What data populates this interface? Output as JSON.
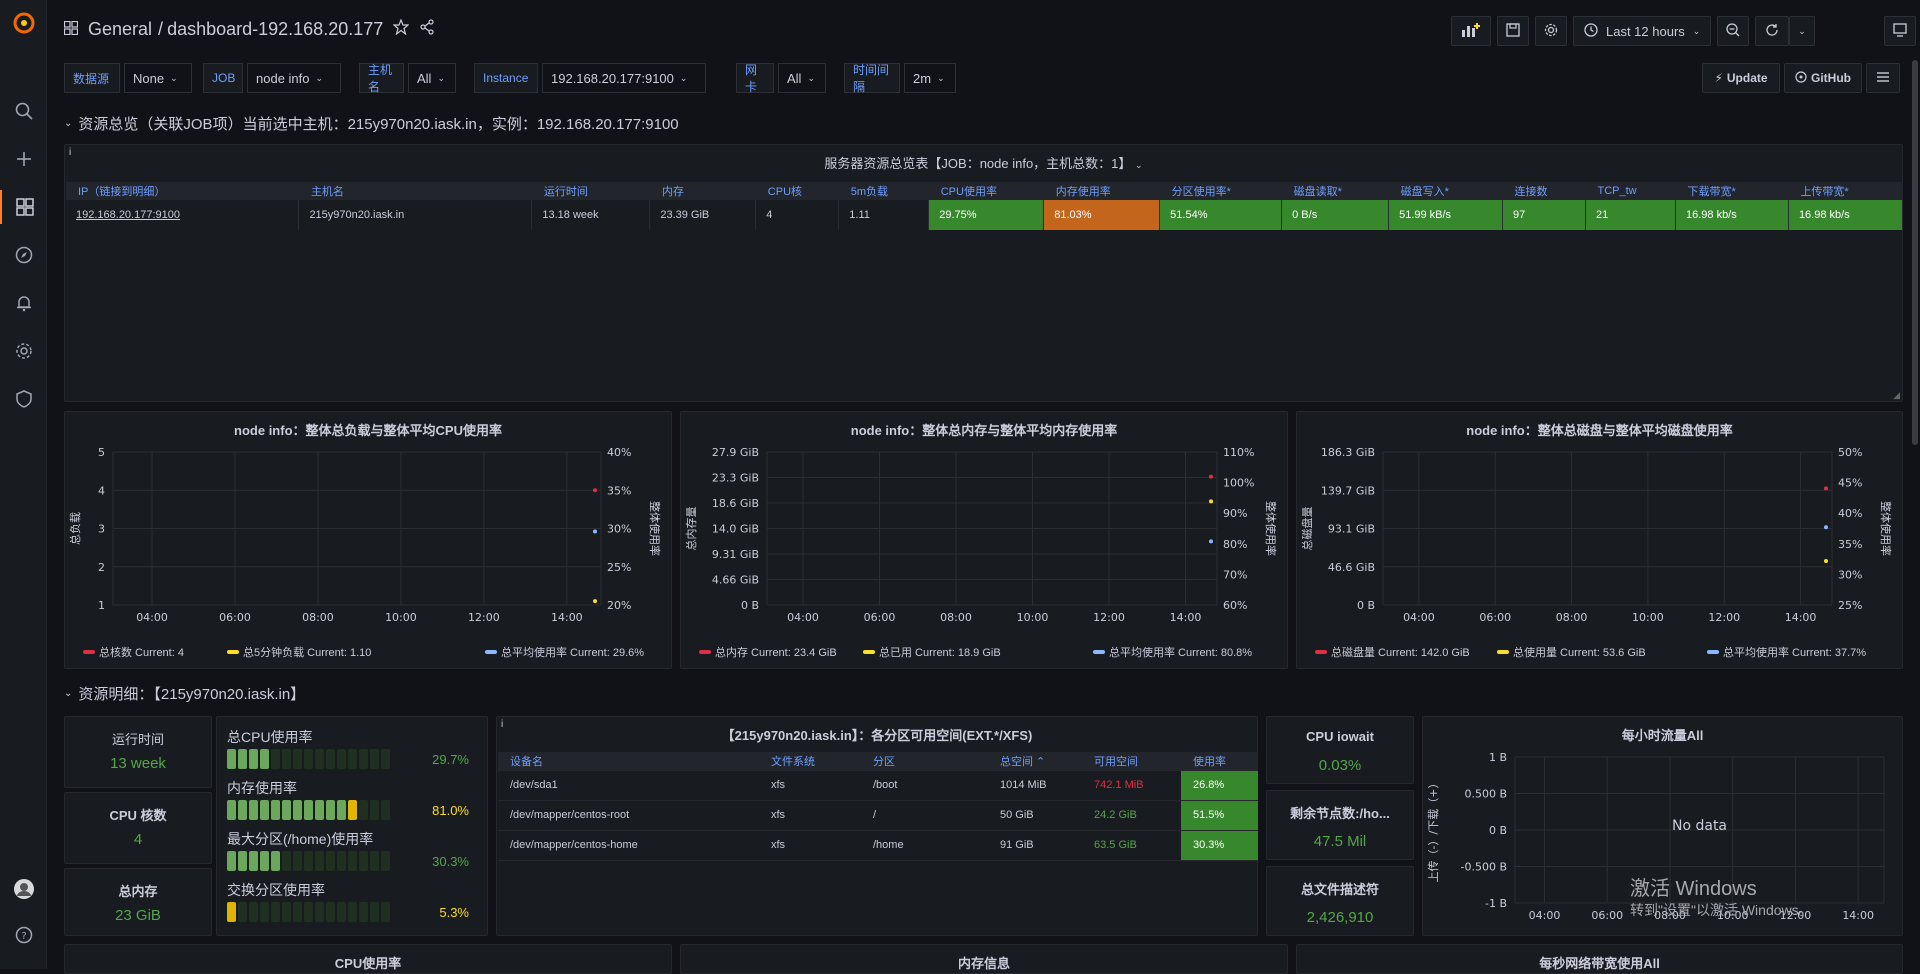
{
  "topbar": {
    "breadcrumb_folder": "General",
    "breadcrumb_sep": "/",
    "dashboard_name": "dashboard-192.168.20.177",
    "time_range": "Last 12 hours",
    "update_label": "Update",
    "github_label": "GitHub"
  },
  "variables": [
    {
      "label": "数据源",
      "value": "None"
    },
    {
      "label": "JOB",
      "value": "node info"
    },
    {
      "label": "主机名",
      "value": "All"
    },
    {
      "label": "Instance",
      "value": "192.168.20.177:9100"
    },
    {
      "label": "网卡",
      "value": "All"
    },
    {
      "label": "时间间隔",
      "value": "2m"
    }
  ],
  "row1_title": "资源总览（关联JOB项）当前选中主机：215y970n20.iask.in，实例：192.168.20.177:9100",
  "overview_panel": {
    "title": "服务器资源总览表【JOB：node info，主机总数：1】",
    "info": "i",
    "columns": [
      "IP（链接到明细）",
      "主机名",
      "运行时间",
      "内存",
      "CPU核",
      "5m负载",
      "CPU使用率",
      "内存使用率",
      "分区使用率*",
      "磁盘读取*",
      "磁盘写入*",
      "连接数",
      "TCP_tw",
      "下载带宽*",
      "上传带宽*"
    ],
    "row": [
      "192.168.20.177:9100",
      "215y970n20.iask.in",
      "13.18 week",
      "23.39 GiB",
      "4",
      "1.11",
      "29.75%",
      "81.03%",
      "51.54%",
      "0 B/s",
      "51.99 kB/s",
      "97",
      "21",
      "16.98 kb/s",
      "16.98 kb/s"
    ]
  },
  "chart_data": [
    {
      "type": "line",
      "title": "node info：整体总负载与整体平均CPU使用率",
      "ylabel": "总负载",
      "y2label": "整体使用率",
      "x": [
        "04:00",
        "06:00",
        "08:00",
        "10:00",
        "12:00",
        "14:00"
      ],
      "yticks": [
        "5",
        "4",
        "3",
        "2",
        "1"
      ],
      "y2ticks": [
        "40%",
        "35%",
        "30%",
        "25%",
        "20%"
      ],
      "ylim": [
        1,
        5
      ],
      "y2lim": [
        20,
        40
      ],
      "series": [
        {
          "name": "总核数",
          "color": "#e02f44",
          "legend": "总核数  Current: 4",
          "axis": "left",
          "value": 4
        },
        {
          "name": "总5分钟负载",
          "color": "#fade2a",
          "legend": "总5分钟负载  Current: 1.10",
          "axis": "left",
          "value": 1.1
        },
        {
          "name": "总平均使用率",
          "color": "#8ab8ff",
          "legend": "总平均使用率  Current: 29.6%",
          "axis": "right",
          "value": 29.6
        }
      ]
    },
    {
      "type": "line",
      "title": "node info：整体总内存与整体平均内存使用率",
      "ylabel": "总内存量",
      "y2label": "整体使用率",
      "x": [
        "04:00",
        "06:00",
        "08:00",
        "10:00",
        "12:00",
        "14:00"
      ],
      "yticks": [
        "27.9 GiB",
        "23.3 GiB",
        "18.6 GiB",
        "14.0 GiB",
        "9.31 GiB",
        "4.66 GiB",
        "0 B"
      ],
      "y2ticks": [
        "110%",
        "100%",
        "90%",
        "80%",
        "70%",
        "60%"
      ],
      "ylim": [
        0,
        27.9
      ],
      "y2lim": [
        60,
        110
      ],
      "series": [
        {
          "name": "总内存",
          "color": "#e02f44",
          "legend": "总内存  Current: 23.4 GiB",
          "axis": "left",
          "value": 23.4
        },
        {
          "name": "总已用",
          "color": "#fade2a",
          "legend": "总已用  Current: 18.9 GiB",
          "axis": "left",
          "value": 18.9
        },
        {
          "name": "总平均使用率",
          "color": "#8ab8ff",
          "legend": "总平均使用率  Current: 80.8%",
          "axis": "right",
          "value": 80.8
        }
      ]
    },
    {
      "type": "line",
      "title": "node info：整体总磁盘与整体平均磁盘使用率",
      "ylabel": "总磁盘量",
      "y2label": "整体使用率",
      "x": [
        "04:00",
        "06:00",
        "08:00",
        "10:00",
        "12:00",
        "14:00"
      ],
      "yticks": [
        "186.3 GiB",
        "139.7 GiB",
        "93.1 GiB",
        "46.6 GiB",
        "0 B"
      ],
      "y2ticks": [
        "50%",
        "45%",
        "40%",
        "35%",
        "30%",
        "25%"
      ],
      "ylim": [
        0,
        186.3
      ],
      "y2lim": [
        25,
        50
      ],
      "series": [
        {
          "name": "总磁盘量",
          "color": "#e02f44",
          "legend": "总磁盘量  Current: 142.0 GiB",
          "axis": "left",
          "value": 142.0
        },
        {
          "name": "总使用量",
          "color": "#fade2a",
          "legend": "总使用量  Current: 53.6 GiB",
          "axis": "left",
          "value": 53.6
        },
        {
          "name": "总平均使用率",
          "color": "#8ab8ff",
          "legend": "总平均使用率  Current: 37.7%",
          "axis": "right",
          "value": 37.7
        }
      ]
    },
    {
      "type": "line",
      "title": "每小时流量All",
      "ylabel": "上传（-）/下载（+）",
      "x": [
        "04:00",
        "06:00",
        "08:00",
        "10:00",
        "12:00",
        "14:00"
      ],
      "yticks": [
        "1 B",
        "0.500 B",
        "0 B",
        "-0.500 B",
        "-1 B"
      ],
      "ylim": [
        -1,
        1
      ],
      "no_data": "No data",
      "series": []
    }
  ],
  "row2_title": "资源明细：【215y970n20.iask.in】",
  "stats": {
    "uptime_label": "运行时间",
    "uptime_value": "13 week",
    "cores_label": "CPU 核数",
    "cores_value": "4",
    "mem_label": "总内存",
    "mem_value": "23 GiB",
    "iowait_label": "CPU iowait",
    "iowait_value": "0.03%",
    "inodes_label": "剩余节点数:/ho...",
    "inodes_value": "47.5 Mil",
    "fd_label": "总文件描述符",
    "fd_value": "2,426,910"
  },
  "gauges": [
    {
      "label": "总CPU使用率",
      "value": "29.7%",
      "fraction": 0.297,
      "color": "#56a64b"
    },
    {
      "label": "内存使用率",
      "value": "81.0%",
      "fraction": 0.81,
      "color": "#fade2a"
    },
    {
      "label": "最大分区(/home)使用率",
      "value": "30.3%",
      "fraction": 0.303,
      "color": "#56a64b"
    },
    {
      "label": "交换分区使用率",
      "value": "5.3%",
      "fraction": 0.053,
      "color": "#fade2a"
    }
  ],
  "partition_panel": {
    "title": "【215y970n20.iask.in】：各分区可用空间(EXT.*/XFS)",
    "info": "i",
    "columns": [
      "设备名",
      "文件系统",
      "分区",
      "总空间 ⌃",
      "可用空间",
      "使用率"
    ],
    "rows": [
      [
        "/dev/sda1",
        "xfs",
        "/boot",
        "1014 MiB",
        "742.1 MiB",
        "26.8%"
      ],
      [
        "/dev/mapper/centos-root",
        "xfs",
        "/",
        "50 GiB",
        "24.2 GiB",
        "51.5%"
      ],
      [
        "/dev/mapper/centos-home",
        "xfs",
        "/home",
        "91 GiB",
        "63.5 GiB",
        "30.3%"
      ]
    ],
    "avail_colors": [
      "#e02f44",
      "#56a64b",
      "#56a64b"
    ]
  },
  "bottom_titles": [
    "CPU使用率",
    "内存信息",
    "每秒网络带宽使用All"
  ],
  "watermark": {
    "line1": "激活 Windows",
    "line2": "转到\"设置\"以激活 Windows。"
  },
  "colors": {
    "accent": "#ff7f2a",
    "green": "#37872d",
    "orange": "#c4651c",
    "blue_label": "#6e9fff"
  }
}
